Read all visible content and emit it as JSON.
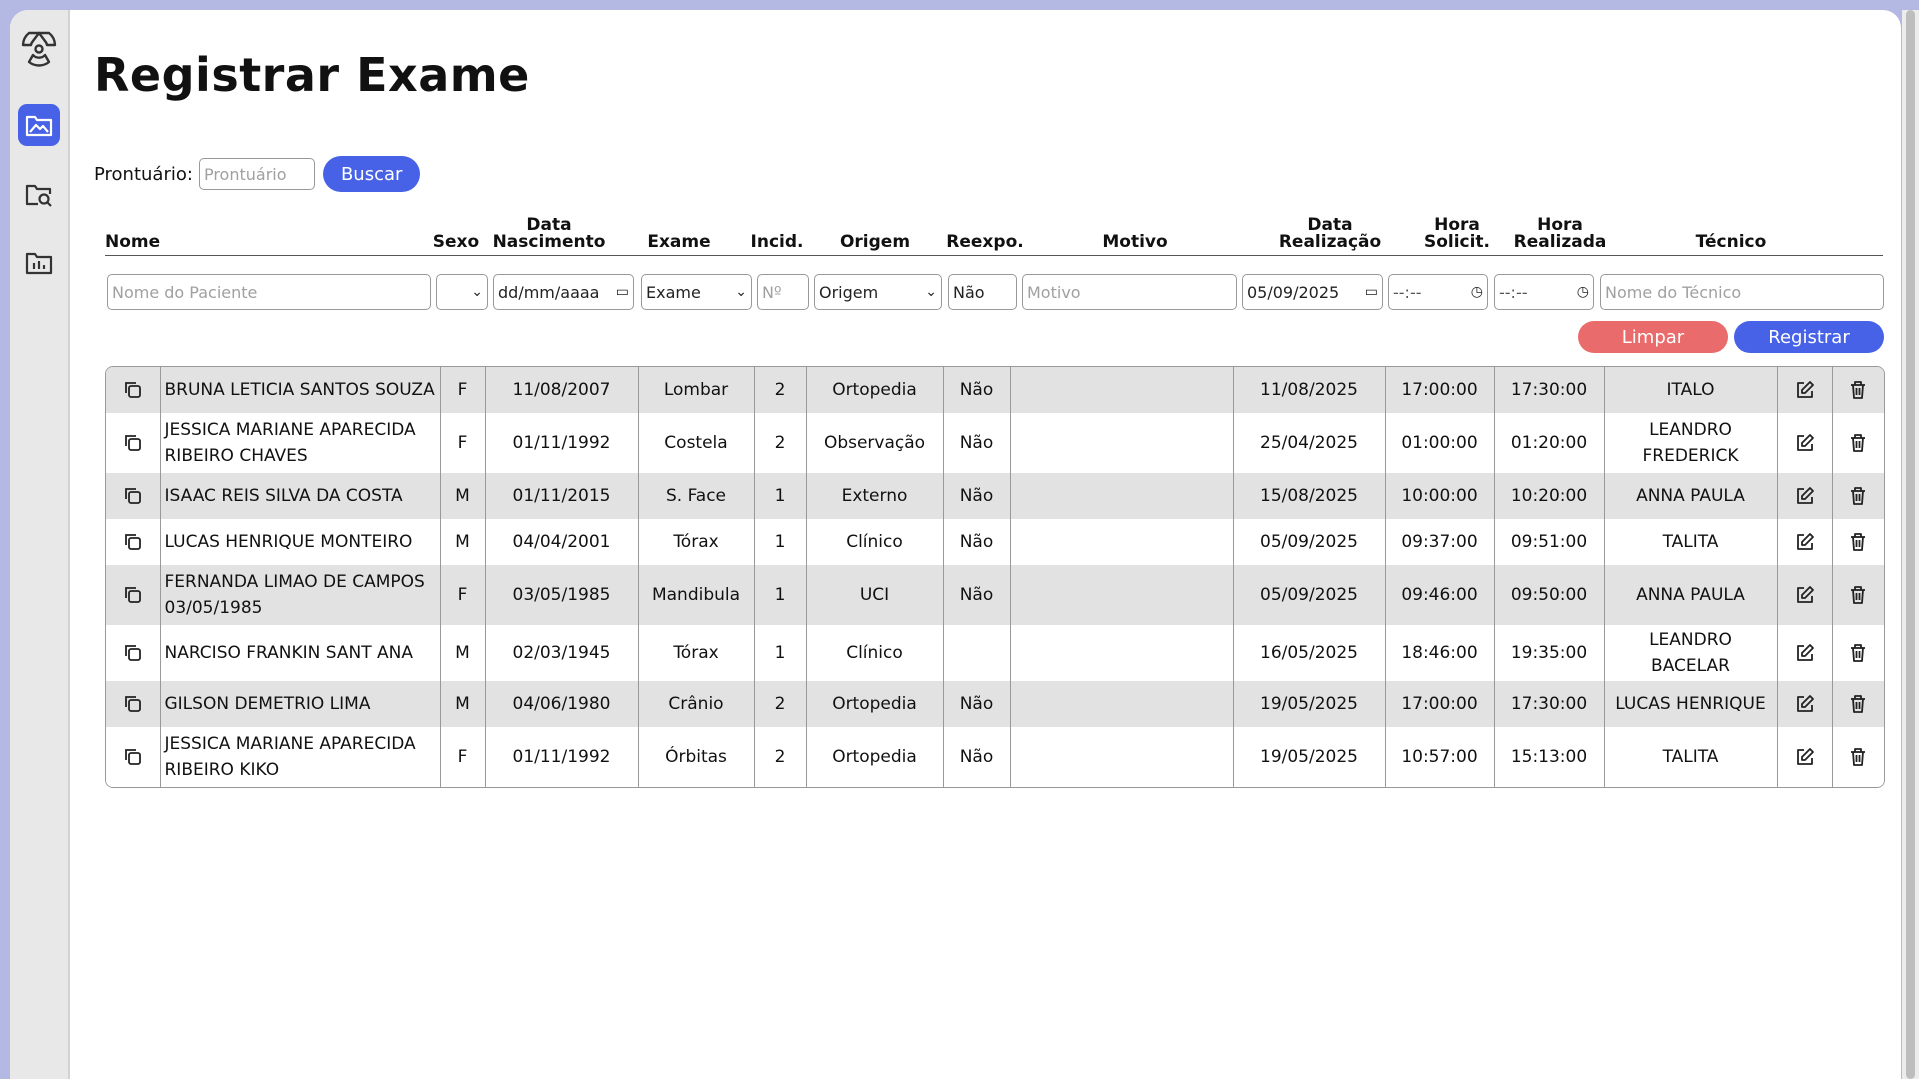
{
  "page": {
    "title": "Registrar Exame",
    "search_label": "Prontuário:",
    "search_placeholder": "Prontuário",
    "search_button": "Buscar"
  },
  "sidebar": {
    "items": [
      {
        "icon": "radiation-icon"
      },
      {
        "icon": "image-folder-icon",
        "active": true
      },
      {
        "icon": "folder-search-icon"
      },
      {
        "icon": "folder-chart-icon"
      }
    ]
  },
  "columns": {
    "nome": "Nome",
    "sexo": "Sexo",
    "data_nasc_1": "Data",
    "data_nasc_2": "Nascimento",
    "exame": "Exame",
    "incid": "Incid.",
    "origem": "Origem",
    "reexpo": "Reexpo.",
    "motivo": "Motivo",
    "data_real_1": "Data",
    "data_real_2": "Realização",
    "hora_sol_1": "Hora",
    "hora_sol_2": "Solicit.",
    "hora_real_1": "Hora",
    "hora_real_2": "Realizada",
    "tecnico": "Técnico"
  },
  "form": {
    "nome_placeholder": "Nome do Paciente",
    "sexo_value": "",
    "data_nasc_value": "dd/mm/aaaa",
    "exame_value": "Exame",
    "incid_placeholder": "Nº",
    "origem_value": "Origem",
    "reexpo_value": "Não",
    "motivo_placeholder": "Motivo",
    "data_real_value": "05/09/2025",
    "hora_sol_value": "--:--",
    "hora_real_value": "--:--",
    "tecnico_placeholder": "Nome do Técnico",
    "clear_button": "Limpar",
    "register_button": "Registrar"
  },
  "rows": [
    {
      "nome": "BRUNA LETICIA SANTOS SOUZA",
      "sexo": "F",
      "nasc": "11/08/2007",
      "exame": "Lombar",
      "incid": "2",
      "origem": "Ortopedia",
      "reexpo": "Não",
      "motivo": "",
      "data": "11/08/2025",
      "hsol": "17:00:00",
      "hreal": "17:30:00",
      "tecnico": "ITALO"
    },
    {
      "nome": "JESSICA MARIANE APARECIDA RIBEIRO CHAVES",
      "sexo": "F",
      "nasc": "01/11/1992",
      "exame": "Costela",
      "incid": "2",
      "origem": "Observação",
      "reexpo": "Não",
      "motivo": "",
      "data": "25/04/2025",
      "hsol": "01:00:00",
      "hreal": "01:20:00",
      "tecnico": "LEANDRO FREDERICK"
    },
    {
      "nome": "ISAAC REIS SILVA DA COSTA",
      "sexo": "M",
      "nasc": "01/11/2015",
      "exame": "S. Face",
      "incid": "1",
      "origem": "Externo",
      "reexpo": "Não",
      "motivo": "",
      "data": "15/08/2025",
      "hsol": "10:00:00",
      "hreal": "10:20:00",
      "tecnico": "ANNA PAULA"
    },
    {
      "nome": "LUCAS HENRIQUE MONTEIRO",
      "sexo": "M",
      "nasc": "04/04/2001",
      "exame": "Tórax",
      "incid": "1",
      "origem": "Clínico",
      "reexpo": "Não",
      "motivo": "",
      "data": "05/09/2025",
      "hsol": "09:37:00",
      "hreal": "09:51:00",
      "tecnico": "TALITA"
    },
    {
      "nome": "FERNANDA LIMAO DE CAMPOS 03/05/1985",
      "sexo": "F",
      "nasc": "03/05/1985",
      "exame": "Mandibula",
      "incid": "1",
      "origem": "UCI",
      "reexpo": "Não",
      "motivo": "",
      "data": "05/09/2025",
      "hsol": "09:46:00",
      "hreal": "09:50:00",
      "tecnico": "ANNA PAULA"
    },
    {
      "nome": "NARCISO FRANKIN SANT ANA",
      "sexo": "M",
      "nasc": "02/03/1945",
      "exame": "Tórax",
      "incid": "1",
      "origem": "Clínico",
      "reexpo": "",
      "motivo": "",
      "data": "16/05/2025",
      "hsol": "18:46:00",
      "hreal": "19:35:00",
      "tecnico": "LEANDRO BACELAR"
    },
    {
      "nome": "GILSON DEMETRIO LIMA",
      "sexo": "M",
      "nasc": "04/06/1980",
      "exame": "Crânio",
      "incid": "2",
      "origem": "Ortopedia",
      "reexpo": "Não",
      "motivo": "",
      "data": "19/05/2025",
      "hsol": "17:00:00",
      "hreal": "17:30:00",
      "tecnico": "LUCAS HENRIQUE"
    },
    {
      "nome": "JESSICA MARIANE APARECIDA RIBEIRO KIKO",
      "sexo": "F",
      "nasc": "01/11/1992",
      "exame": "Órbitas",
      "incid": "2",
      "origem": "Ortopedia",
      "reexpo": "Não",
      "motivo": "",
      "data": "19/05/2025",
      "hsol": "10:57:00",
      "hreal": "15:13:00",
      "tecnico": "TALITA"
    }
  ],
  "colors": {
    "accent": "#4762e6",
    "danger": "#ea6b6b",
    "background": "#b3b9e3",
    "row_stripe": "#e2e2e2"
  }
}
